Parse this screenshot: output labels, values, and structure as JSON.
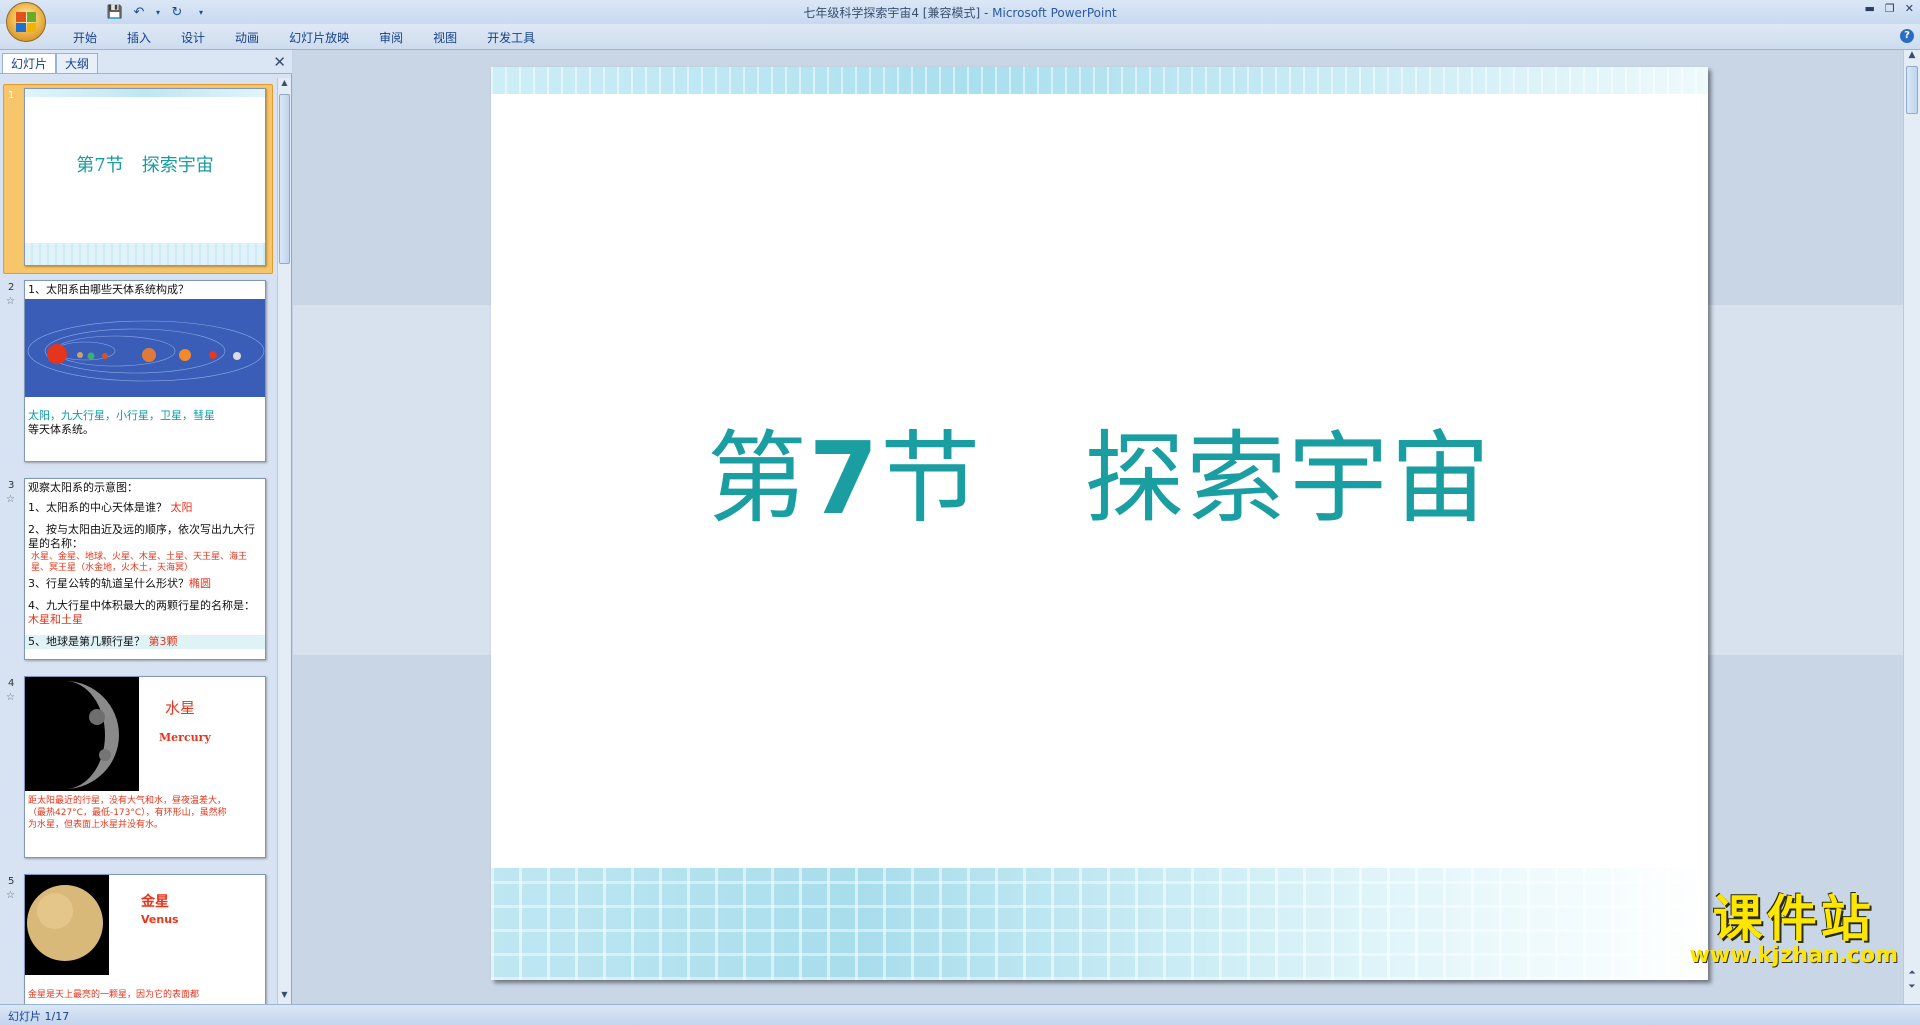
{
  "window": {
    "title": "七年级科学探索宇宙4 [兼容模式] - ",
    "app_name": "Microsoft PowerPoint"
  },
  "ribbon": {
    "tabs": [
      "开始",
      "插入",
      "设计",
      "动画",
      "幻灯片放映",
      "审阅",
      "视图",
      "开发工具"
    ]
  },
  "left_pane": {
    "tabs": [
      "幻灯片",
      "大纲"
    ],
    "slides": [
      {
        "num": "1",
        "title": "第7节　探索宇宙"
      },
      {
        "num": "2",
        "question": "1、太阳系由哪些天体系统构成？",
        "answer_1": "太阳，九大行星，小行星，卫星，彗星",
        "answer_2": "等天体系统。"
      },
      {
        "num": "3",
        "heading": "观察太阳系的示意图：",
        "q1": "1、太阳系的中心天体是谁？",
        "a1": "太阳",
        "q2": "2、按与太阳由近及远的顺序，依次写出九大行星的名称：",
        "a2": "水星、金星、地球、火星、木星、土星、天王星、海王星、冥王星（水金地，火木土，天海冥）",
        "q3": "3、行星公转的轨道呈什么形状？",
        "a3": "椭圆",
        "q4": "4、九大行星中体积最大的两颗行星的名称是：",
        "a4": "木星和土星",
        "q5": "5、地球是第几颗行星？",
        "a5": "第3颗"
      },
      {
        "num": "4",
        "name_cn": "水星",
        "name_en": "Mercury",
        "desc": "距太阳最近的行星，没有大气和水，昼夜温差大，（最热427°C，最低-173°C），有环形山，虽然称为水星，但表面上水星并没有水。"
      },
      {
        "num": "5",
        "name_cn": "金星",
        "name_en": "Venus",
        "desc": "金星是天上最亮的一颗星，因为它的表面都"
      }
    ]
  },
  "slide": {
    "title_part1": "第",
    "title_num": "7",
    "title_part2": "节　探索宇宙"
  },
  "watermark": {
    "big": "课件站",
    "url": "www.kjzhan.com"
  },
  "status": {
    "slide_counter": "幻灯片 1/17"
  },
  "colors": {
    "title_teal": "#1a9ea1",
    "answer_red": "#e7341b",
    "watermark_yellow": "#ffe600"
  }
}
